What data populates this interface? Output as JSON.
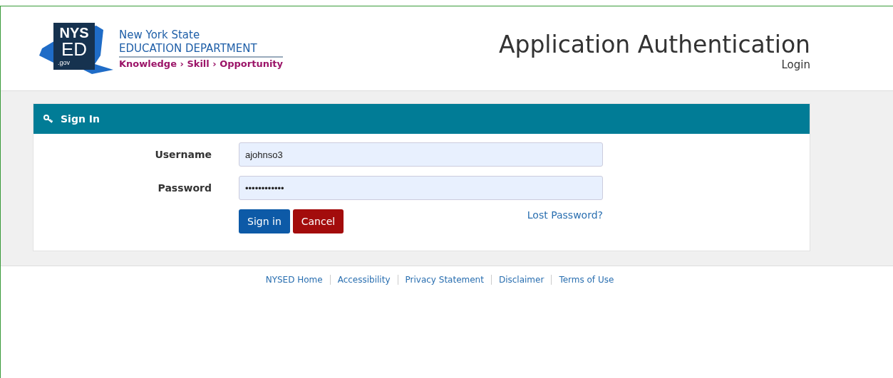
{
  "header": {
    "logo": {
      "line_1": "NYS",
      "line_2": "ED",
      "line_3": ".gov"
    },
    "org_name": "New York State",
    "department": "EDUCATION DEPARTMENT",
    "tagline": "Knowledge › Skill › Opportunity",
    "title": "Application Authentication",
    "subtitle": "Login"
  },
  "panel": {
    "title": "Sign In",
    "fields": [
      {
        "label": "Username",
        "value": "ajohnso3"
      },
      {
        "label": "Password",
        "value": "••••••••••••"
      }
    ],
    "buttons": [
      {
        "label": "Sign in",
        "kind": "primary"
      },
      {
        "label": "Cancel",
        "kind": "danger"
      }
    ],
    "link": "Lost Password?"
  },
  "footer_links": [
    "NYSED Home",
    "Accessibility",
    "Privacy Statement",
    "Disclaimer",
    "Terms of Use"
  ]
}
